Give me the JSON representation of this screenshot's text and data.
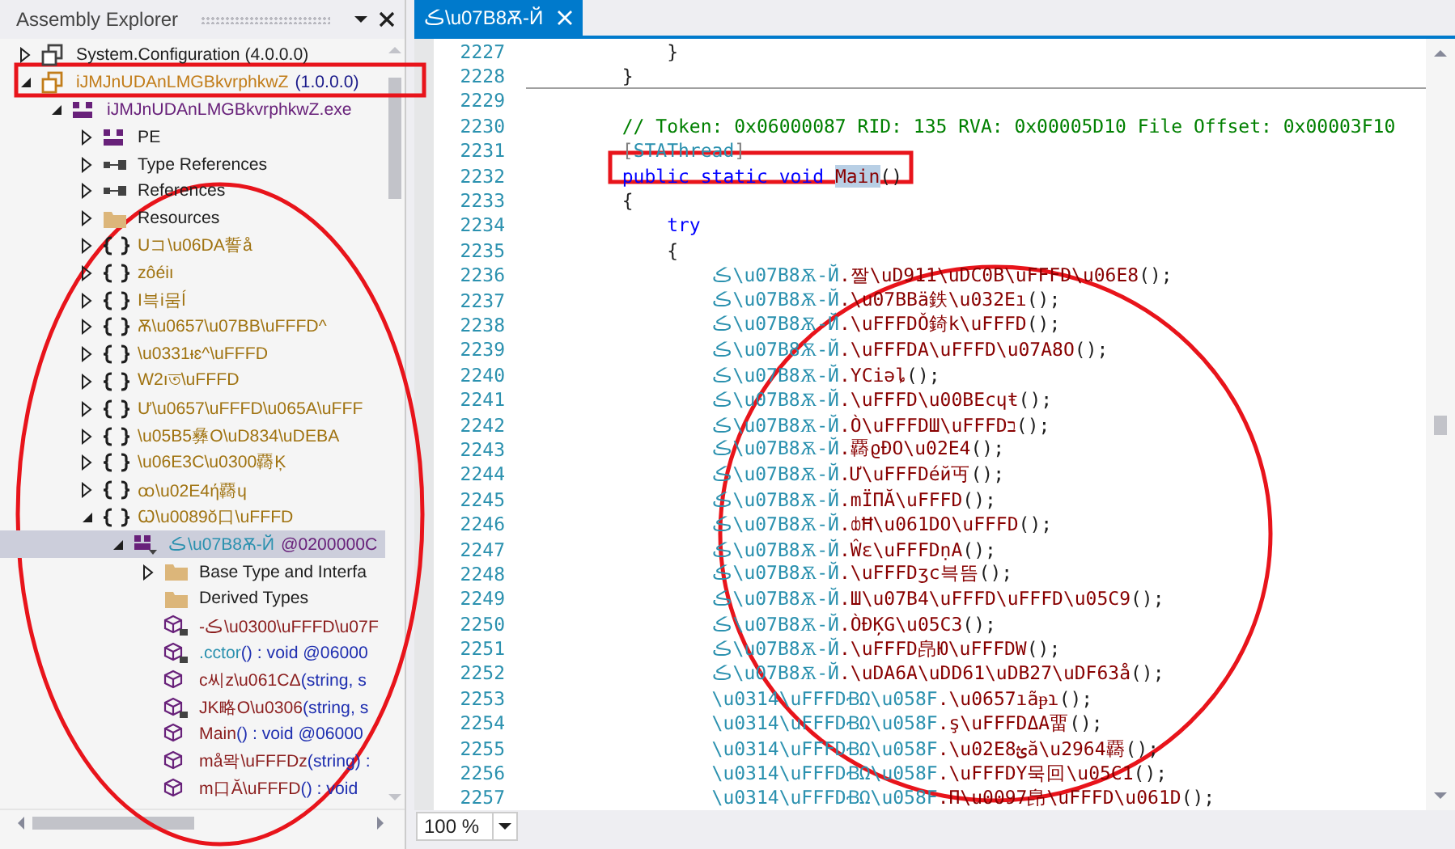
{
  "explorer": {
    "title": "Assembly Explorer"
  },
  "tree": [
    {
      "kind": "assembly",
      "label": "System.Configuration (4.0.0.0)",
      "expanded": false,
      "selected": false
    },
    {
      "kind": "assembly",
      "label": "iJMJnUDAnLMGBkvrphkwZ",
      "version": "(1.0.0.0)",
      "expanded": true,
      "selected": false,
      "children": [
        {
          "kind": "module",
          "label": "iJMJnUDAnLMGBkvrphkwZ.exe",
          "expanded": true,
          "selected": false,
          "children": [
            {
              "kind": "pe",
              "label": "PE",
              "expanded": false,
              "selected": false
            },
            {
              "kind": "references",
              "label": "Type References",
              "expanded": false,
              "selected": false
            },
            {
              "kind": "references",
              "label": "References",
              "expanded": false,
              "selected": false
            },
            {
              "kind": "folder",
              "label": "Resources",
              "expanded": false,
              "selected": false
            },
            {
              "kind": "namespace",
              "label": "Uコ\\u06DA誓å",
              "expanded": false,
              "selected": false
            },
            {
              "kind": "namespace",
              "label": "zôéiı",
              "expanded": false,
              "selected": false
            },
            {
              "kind": "namespace",
              "label": "I븍i뭄ĺ",
              "expanded": false,
              "selected": false
            },
            {
              "kind": "namespace",
              "label": "Ѫ\\u0657\\u07BB\\uFFFD^",
              "expanded": false,
              "selected": false
            },
            {
              "kind": "namespace",
              "label": "\\u0331ᵻɛ^\\uFFFD",
              "expanded": false,
              "selected": false
            },
            {
              "kind": "namespace",
              "label": "W2ıত\\uFFFD",
              "expanded": false,
              "selected": false
            },
            {
              "kind": "namespace",
              "label": "Ư\\u0657\\uFFFD\\u065A\\uFFF",
              "expanded": false,
              "selected": false
            },
            {
              "kind": "namespace",
              "label": "\\u05B5彝O\\uD834\\uDEBA",
              "expanded": false,
              "selected": false
            },
            {
              "kind": "namespace",
              "label": "\\u06E3C\\u0300覉Ķ",
              "expanded": false,
              "selected": false
            },
            {
              "kind": "namespace",
              "label": "ꝏ\\u02E4ή覉ɥ",
              "expanded": false,
              "selected": false
            },
            {
              "kind": "namespace",
              "label": "Ꞷ\\u0089ŏ口\\uFFFD",
              "expanded": true,
              "selected": false,
              "children": [
                {
                  "kind": "class",
                  "label": "ڪ\\u07B8Ѫ-Й",
                  "token": "@0200000C",
                  "expanded": true,
                  "selected": true,
                  "children": [
                    {
                      "kind": "folder",
                      "label": "Base Type and Interfa",
                      "expanded": false,
                      "selected": false
                    },
                    {
                      "kind": "folder",
                      "label": "Derived Types",
                      "selected": false
                    },
                    {
                      "kind": "method",
                      "label": "-ڪ\\u0300\\uFFFD\\u07F",
                      "locked": true,
                      "selected": false
                    },
                    {
                      "kind": "constructor",
                      "label": ".cctor",
                      "signature": "() : void @06000",
                      "locked": true,
                      "selected": false
                    },
                    {
                      "kind": "method",
                      "label": "c씨z\\u061CΔ",
                      "signature": "(string, s",
                      "locked": false,
                      "selected": false
                    },
                    {
                      "kind": "method",
                      "label": "JK略O\\u0306",
                      "signature": "(string, s",
                      "locked": true,
                      "selected": false
                    },
                    {
                      "kind": "method",
                      "label": "Main",
                      "signature": "() : void @06000",
                      "locked": false,
                      "selected": false
                    },
                    {
                      "kind": "method",
                      "label": "må뫅\\uFFFDz",
                      "signature": "(string) :",
                      "locked": false,
                      "selected": false
                    },
                    {
                      "kind": "method",
                      "label": "m口Ă\\uFFFD",
                      "signature": "() : void",
                      "locked": false,
                      "selected": false
                    }
                  ]
                }
              ]
            }
          ]
        }
      ]
    }
  ],
  "tab": {
    "label": "ڪ\\u07B8Ѫ-Й",
    "selected": true
  },
  "code_lines": [
    {
      "number": "2227",
      "segments": [
        {
          "kind": "plain",
          "text": "            }"
        }
      ]
    },
    {
      "number": "2228",
      "separator_below": true,
      "segments": [
        {
          "kind": "plain",
          "text": "        }"
        }
      ]
    },
    {
      "number": "2229"
    },
    {
      "number": "2230",
      "segments": [
        {
          "kind": "comment",
          "text": "        // Token: 0x06000087 RID: 135 RVA: 0x00005D10 File Offset: 0x00003F10"
        }
      ]
    },
    {
      "number": "2231",
      "segments": [
        {
          "kind": "punct",
          "text": "        ["
        },
        {
          "kind": "type",
          "text": "STAThread"
        },
        {
          "kind": "punct",
          "text": "]"
        }
      ]
    },
    {
      "number": "2232",
      "segments": [
        {
          "kind": "keyword",
          "text": "        public static void "
        },
        {
          "kind": "highlight",
          "text": "Main"
        },
        {
          "kind": "plain",
          "text": "()"
        }
      ]
    },
    {
      "number": "2233",
      "segments": [
        {
          "kind": "plain",
          "text": "        {"
        }
      ]
    },
    {
      "number": "2234",
      "segments": [
        {
          "kind": "keyword",
          "text": "            try"
        }
      ]
    },
    {
      "number": "2235",
      "segments": [
        {
          "kind": "plain",
          "text": "            {"
        }
      ]
    },
    {
      "number": "2236",
      "segments": [
        {
          "kind": "type",
          "text": "                ڪ\\u07B8Ѫ-Й"
        },
        {
          "kind": "method",
          "text": ".짤\\uD911\\uDC0B\\uFFFD\\u06E8"
        },
        {
          "kind": "plain",
          "text": "();"
        }
      ]
    },
    {
      "number": "2237",
      "segments": [
        {
          "kind": "type",
          "text": "                ڪ\\u07B8Ѫ-Й"
        },
        {
          "kind": "method",
          "text": ".\\u07BBä鉄\\u032Eı"
        },
        {
          "kind": "plain",
          "text": "();"
        }
      ]
    },
    {
      "number": "2238",
      "segments": [
        {
          "kind": "type",
          "text": "                ڪ\\u07B8Ѫ-Й"
        },
        {
          "kind": "method",
          "text": ".\\uFFFDǑ錡k\\uFFFD"
        },
        {
          "kind": "plain",
          "text": "();"
        }
      ]
    },
    {
      "number": "2239",
      "segments": [
        {
          "kind": "type",
          "text": "                ڪ\\u07B8Ѫ-Й"
        },
        {
          "kind": "method",
          "text": ".\\uFFFDA\\uFFFD\\u07A8O"
        },
        {
          "kind": "plain",
          "text": "();"
        }
      ]
    },
    {
      "number": "2240",
      "segments": [
        {
          "kind": "type",
          "text": "                ڪ\\u07B8Ѫ-Й"
        },
        {
          "kind": "method",
          "text": ".ҮCiǝȴ"
        },
        {
          "kind": "plain",
          "text": "();"
        }
      ]
    },
    {
      "number": "2241",
      "segments": [
        {
          "kind": "type",
          "text": "                ڪ\\u07B8Ѫ-Й"
        },
        {
          "kind": "method",
          "text": ".\\uFFFD\\u00BEcɥŧ"
        },
        {
          "kind": "plain",
          "text": "();"
        }
      ]
    },
    {
      "number": "2242",
      "segments": [
        {
          "kind": "type",
          "text": "                ڪ\\u07B8Ѫ-Й"
        },
        {
          "kind": "method",
          "text": ".Ò\\uFFFDШ\\uFFFDב"
        },
        {
          "kind": "plain",
          "text": "();"
        }
      ]
    },
    {
      "number": "2243",
      "segments": [
        {
          "kind": "type",
          "text": "                ڪ\\u07B8Ѫ-Й"
        },
        {
          "kind": "method",
          "text": ".覉ϱÐO\\u02E4"
        },
        {
          "kind": "plain",
          "text": "();"
        }
      ]
    },
    {
      "number": "2244",
      "segments": [
        {
          "kind": "type",
          "text": "                ڪ\\u07B8Ѫ-Й"
        },
        {
          "kind": "method",
          "text": ".Ư\\uFFFDéй丏"
        },
        {
          "kind": "plain",
          "text": "();"
        }
      ]
    },
    {
      "number": "2245",
      "segments": [
        {
          "kind": "type",
          "text": "                ڪ\\u07B8Ѫ-Й"
        },
        {
          "kind": "method",
          "text": ".mÏΠĂ\\uFFFD"
        },
        {
          "kind": "plain",
          "text": "();"
        }
      ]
    },
    {
      "number": "2246",
      "segments": [
        {
          "kind": "type",
          "text": "                ڪ\\u07B8Ѫ-Й"
        },
        {
          "kind": "method",
          "text": ".ȸĦ\\u061DO\\uFFFD"
        },
        {
          "kind": "plain",
          "text": "();"
        }
      ]
    },
    {
      "number": "2247",
      "segments": [
        {
          "kind": "type",
          "text": "                ڪ\\u07B8Ѫ-Й"
        },
        {
          "kind": "method",
          "text": ".Ŵɛ\\uFFFDṇA"
        },
        {
          "kind": "plain",
          "text": "();"
        }
      ]
    },
    {
      "number": "2248",
      "segments": [
        {
          "kind": "type",
          "text": "                ڪ\\u07B8Ѫ-Й"
        },
        {
          "kind": "method",
          "text": ".\\uFFFDʒc븍뜸"
        },
        {
          "kind": "plain",
          "text": "();"
        }
      ]
    },
    {
      "number": "2249",
      "segments": [
        {
          "kind": "type",
          "text": "                ڪ\\u07B8Ѫ-Й"
        },
        {
          "kind": "method",
          "text": ".Ш\\u07B4\\uFFFD\\uFFFD\\u05C9"
        },
        {
          "kind": "plain",
          "text": "();"
        }
      ]
    },
    {
      "number": "2250",
      "segments": [
        {
          "kind": "type",
          "text": "                ڪ\\u07B8Ѫ-Й"
        },
        {
          "kind": "method",
          "text": ".ÒĐĶG\\u05C3"
        },
        {
          "kind": "plain",
          "text": "();"
        }
      ]
    },
    {
      "number": "2251",
      "segments": [
        {
          "kind": "type",
          "text": "                ڪ\\u07B8Ѫ-Й"
        },
        {
          "kind": "method",
          "text": ".\\uFFFD皍Ю\\uFFFDW"
        },
        {
          "kind": "plain",
          "text": "();"
        }
      ]
    },
    {
      "number": "2252",
      "segments": [
        {
          "kind": "type",
          "text": "                ڪ\\u07B8Ѫ-Й"
        },
        {
          "kind": "method",
          "text": ".\\uDA6A\\uDD61\\uDB27\\uDF63å"
        },
        {
          "kind": "plain",
          "text": "();"
        }
      ]
    },
    {
      "number": "2253",
      "segments": [
        {
          "kind": "type",
          "text": "                \\u0314\\uFFFDꞖΩ\\u058F"
        },
        {
          "kind": "method",
          "text": ".\\u0657ıãᵽɿ"
        },
        {
          "kind": "plain",
          "text": "();"
        }
      ]
    },
    {
      "number": "2254",
      "segments": [
        {
          "kind": "type",
          "text": "                \\u0314\\uFFFDꞖΩ\\u058F"
        },
        {
          "kind": "method",
          "text": ".ş\\uFFFDΔA畱"
        },
        {
          "kind": "plain",
          "text": "();"
        }
      ]
    },
    {
      "number": "2255",
      "segments": [
        {
          "kind": "type",
          "text": "                \\u0314\\uFFFDꞖΩ\\u058F"
        },
        {
          "kind": "method",
          "text": ".\\u02E8ؿă\\u2964覉"
        },
        {
          "kind": "plain",
          "text": "();"
        }
      ]
    },
    {
      "number": "2256",
      "segments": [
        {
          "kind": "type",
          "text": "                \\u0314\\uFFFDꞖΩ\\u058F"
        },
        {
          "kind": "method",
          "text": ".\\uFFFDY묵回\\u05C1"
        },
        {
          "kind": "plain",
          "text": "();"
        }
      ]
    },
    {
      "number": "2257",
      "segments": [
        {
          "kind": "type",
          "text": "                \\u0314\\uFFFDꞖΩ\\u058F"
        },
        {
          "kind": "method",
          "text": ".Π\\u0097皍\\uFFFD\\u061D"
        },
        {
          "kind": "plain",
          "text": "();"
        }
      ]
    }
  ],
  "zoom": {
    "value": "100 %"
  }
}
